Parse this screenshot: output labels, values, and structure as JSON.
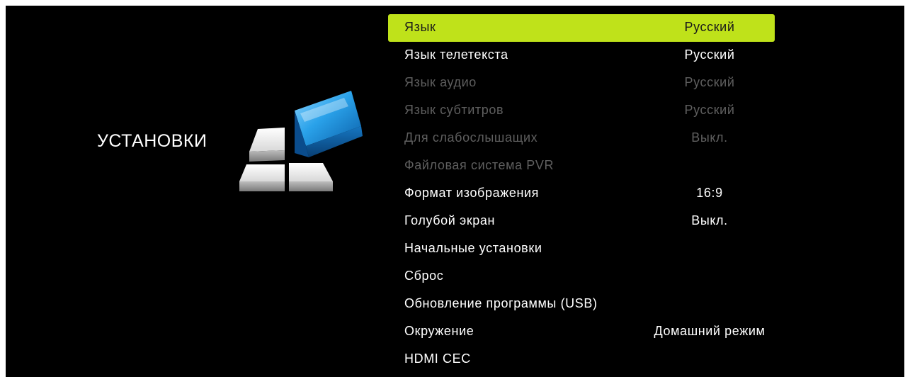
{
  "section": {
    "title": "УСТАНОВКИ",
    "icon": "settings-blocks-icon"
  },
  "colors": {
    "background": "#000000",
    "highlight": "#bfe21a",
    "text_enabled": "#ffffff",
    "text_disabled": "#5f5f5f",
    "icon_blue": "#2a9be0",
    "icon_white": "#e8e8e8"
  },
  "menu": {
    "selected_index": 0,
    "items": [
      {
        "label": "Язык",
        "value": "Русский",
        "enabled": true
      },
      {
        "label": "Язык телетекста",
        "value": "Русский",
        "enabled": true
      },
      {
        "label": "Язык аудио",
        "value": "Русский",
        "enabled": false
      },
      {
        "label": "Язык субтитров",
        "value": "Русский",
        "enabled": false
      },
      {
        "label": "Для слабослышащих",
        "value": "Выкл.",
        "enabled": false
      },
      {
        "label": "Файловая система PVR",
        "value": "",
        "enabled": false
      },
      {
        "label": "Формат изображения",
        "value": "16:9",
        "enabled": true
      },
      {
        "label": "Голубой экран",
        "value": "Выкл.",
        "enabled": true
      },
      {
        "label": "Начальные установки",
        "value": "",
        "enabled": true
      },
      {
        "label": "Сброс",
        "value": "",
        "enabled": true
      },
      {
        "label": "Обновление программы (USB)",
        "value": "",
        "enabled": true
      },
      {
        "label": "Окружение",
        "value": "Домашний режим",
        "enabled": true
      },
      {
        "label": "HDMI CEC",
        "value": "",
        "enabled": true
      }
    ]
  }
}
